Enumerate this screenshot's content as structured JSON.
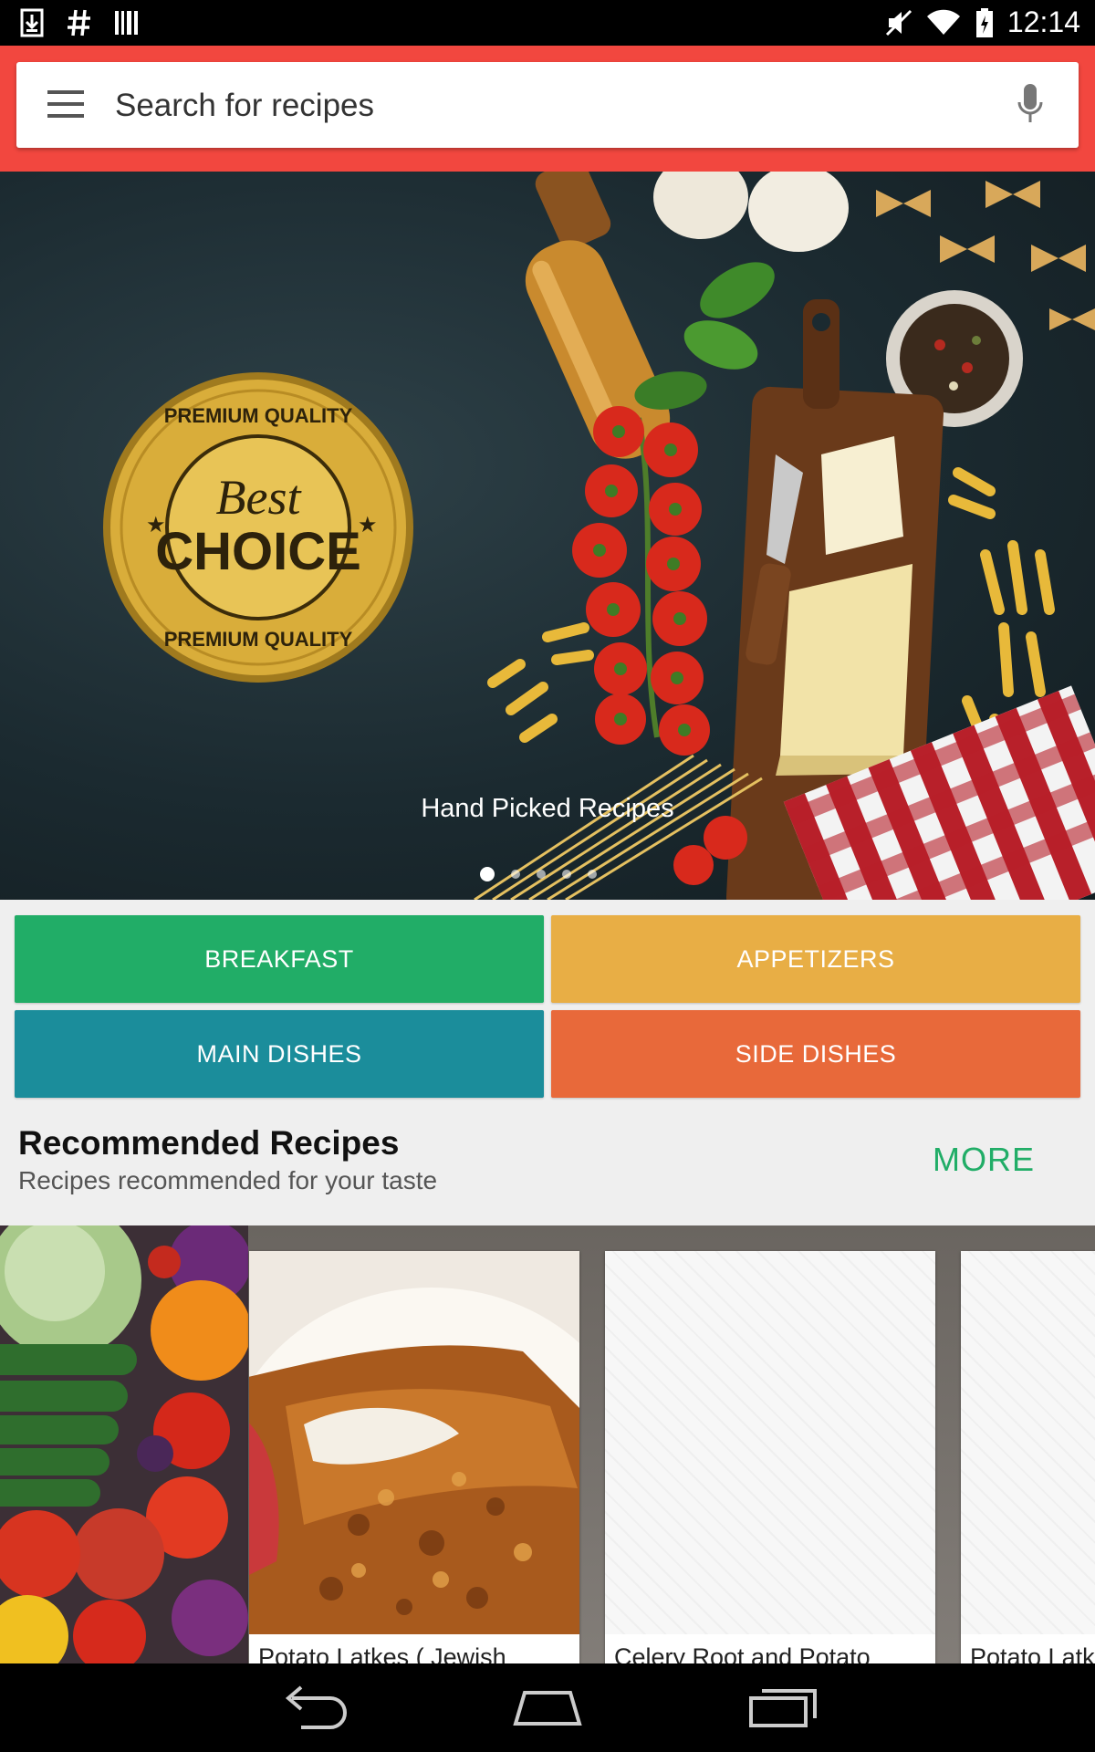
{
  "status_bar": {
    "left_icons": [
      "download-icon",
      "hash-icon",
      "barcode-icon"
    ],
    "right_icons": [
      "mute-icon",
      "wifi-icon",
      "battery-icon"
    ],
    "time": "12:14"
  },
  "search": {
    "placeholder": "Search for recipes"
  },
  "hero": {
    "caption": "Hand Picked Recipes",
    "badge_top": "PREMIUM QUALITY",
    "badge_script": "Best",
    "badge_main": "CHOICE",
    "badge_bottom": "PREMIUM QUALITY",
    "carousel_page": 1,
    "carousel_pages": 5
  },
  "categories": [
    "BREAKFAST",
    "APPETIZERS",
    "MAIN DISHES",
    "SIDE DISHES"
  ],
  "recommended": {
    "title": "Recommended Recipes",
    "subtitle": "Recipes recommended for your taste",
    "more_label": "MORE",
    "cards": [
      {
        "name": "Potato Latkes ( Jewish"
      },
      {
        "name": "Celery Root and Potato"
      },
      {
        "name": "Potato Latk"
      }
    ]
  },
  "nav_bar": [
    "back-icon",
    "home-icon",
    "recents-icon"
  ],
  "colors": {
    "app_bar": "#f2473f",
    "breakfast": "#21ad67",
    "appetizers": "#e8ae45",
    "main_dishes": "#1b8d9b",
    "side_dishes": "#e8693a",
    "more": "#21ad67"
  }
}
